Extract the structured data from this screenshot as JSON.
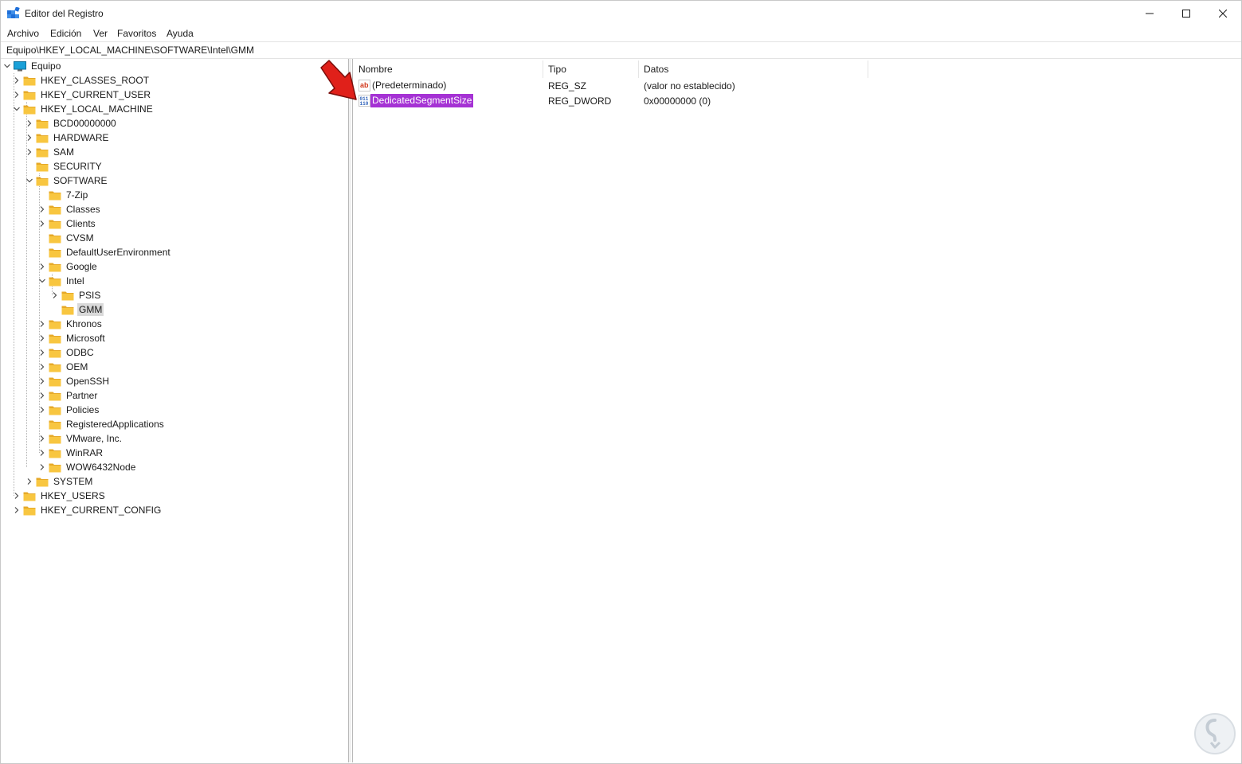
{
  "window": {
    "title": "Editor del Registro",
    "controls": {
      "minimize": "minimize-icon",
      "maximize": "maximize-icon",
      "close": "close-icon"
    }
  },
  "menu": [
    "Archivo",
    "Edición",
    "Ver",
    "Favoritos",
    "Ayuda"
  ],
  "address": "Equipo\\HKEY_LOCAL_MACHINE\\SOFTWARE\\Intel\\GMM",
  "tree": {
    "root": "Equipo",
    "nodes": [
      "HKEY_CLASSES_ROOT",
      "HKEY_CURRENT_USER",
      "HKEY_LOCAL_MACHINE",
      "BCD00000000",
      "HARDWARE",
      "SAM",
      "SECURITY",
      "SOFTWARE",
      "7-Zip",
      "Classes",
      "Clients",
      "CVSM",
      "DefaultUserEnvironment",
      "Google",
      "Intel",
      "PSIS",
      "GMM",
      "Khronos",
      "Microsoft",
      "ODBC",
      "OEM",
      "OpenSSH",
      "Partner",
      "Policies",
      "RegisteredApplications",
      "VMware, Inc.",
      "WinRAR",
      "WOW6432Node",
      "SYSTEM",
      "HKEY_USERS",
      "HKEY_CURRENT_CONFIG"
    ],
    "selected": "GMM"
  },
  "list": {
    "columns": [
      "Nombre",
      "Tipo",
      "Datos"
    ],
    "rows": [
      {
        "name": "(Predeterminado)",
        "type": "REG_SZ",
        "data": "(valor no establecido)",
        "icon": "string-value-icon"
      },
      {
        "name": "DedicatedSegmentSize",
        "type": "REG_DWORD",
        "data": "0x00000000 (0)",
        "icon": "binary-value-icon"
      }
    ],
    "selected_color": "#a532d4"
  },
  "colors": {
    "folder": "#f8c640",
    "selection_tree": "#d9d9d9",
    "arrow": "#e0201a"
  }
}
